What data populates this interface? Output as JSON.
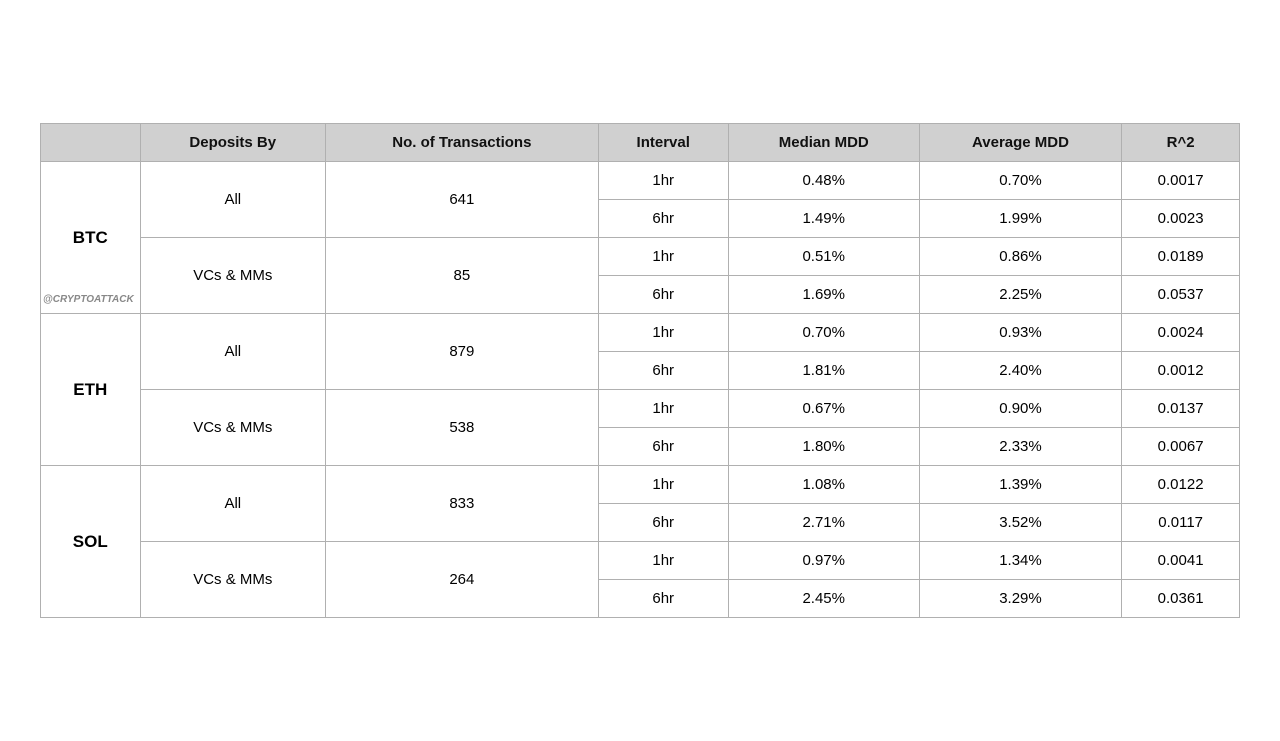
{
  "table": {
    "headers": {
      "col0": "",
      "col1": "Deposits By",
      "col2": "No. of Transactions",
      "col3": "Interval",
      "col4": "Median MDD",
      "col5": "Average MDD",
      "col6": "R^2"
    },
    "groups": [
      {
        "asset": "BTC",
        "watermark": "@CRYPTOATTACK",
        "rows": [
          {
            "deposits_by": "All",
            "transactions": "641",
            "interval": "1hr",
            "median_mdd": "0.48%",
            "average_mdd": "0.70%",
            "r2": "0.0017"
          },
          {
            "deposits_by": "All",
            "transactions": "641",
            "interval": "6hr",
            "median_mdd": "1.49%",
            "average_mdd": "1.99%",
            "r2": "0.0023"
          },
          {
            "deposits_by": "VCs & MMs",
            "transactions": "85",
            "interval": "1hr",
            "median_mdd": "0.51%",
            "average_mdd": "0.86%",
            "r2": "0.0189"
          },
          {
            "deposits_by": "VCs & MMs",
            "transactions": "85",
            "interval": "6hr",
            "median_mdd": "1.69%",
            "average_mdd": "2.25%",
            "r2": "0.0537"
          }
        ]
      },
      {
        "asset": "ETH",
        "watermark": "",
        "rows": [
          {
            "deposits_by": "All",
            "transactions": "879",
            "interval": "1hr",
            "median_mdd": "0.70%",
            "average_mdd": "0.93%",
            "r2": "0.0024"
          },
          {
            "deposits_by": "All",
            "transactions": "879",
            "interval": "6hr",
            "median_mdd": "1.81%",
            "average_mdd": "2.40%",
            "r2": "0.0012"
          },
          {
            "deposits_by": "VCs & MMs",
            "transactions": "538",
            "interval": "1hr",
            "median_mdd": "0.67%",
            "average_mdd": "0.90%",
            "r2": "0.0137"
          },
          {
            "deposits_by": "VCs & MMs",
            "transactions": "538",
            "interval": "6hr",
            "median_mdd": "1.80%",
            "average_mdd": "2.33%",
            "r2": "0.0067"
          }
        ]
      },
      {
        "asset": "SOL",
        "watermark": "",
        "rows": [
          {
            "deposits_by": "All",
            "transactions": "833",
            "interval": "1hr",
            "median_mdd": "1.08%",
            "average_mdd": "1.39%",
            "r2": "0.0122"
          },
          {
            "deposits_by": "All",
            "transactions": "833",
            "interval": "6hr",
            "median_mdd": "2.71%",
            "average_mdd": "3.52%",
            "r2": "0.0117"
          },
          {
            "deposits_by": "VCs & MMs",
            "transactions": "264",
            "interval": "1hr",
            "median_mdd": "0.97%",
            "average_mdd": "1.34%",
            "r2": "0.0041"
          },
          {
            "deposits_by": "VCs & MMs",
            "transactions": "264",
            "interval": "6hr",
            "median_mdd": "2.45%",
            "average_mdd": "3.29%",
            "r2": "0.0361"
          }
        ]
      }
    ]
  }
}
